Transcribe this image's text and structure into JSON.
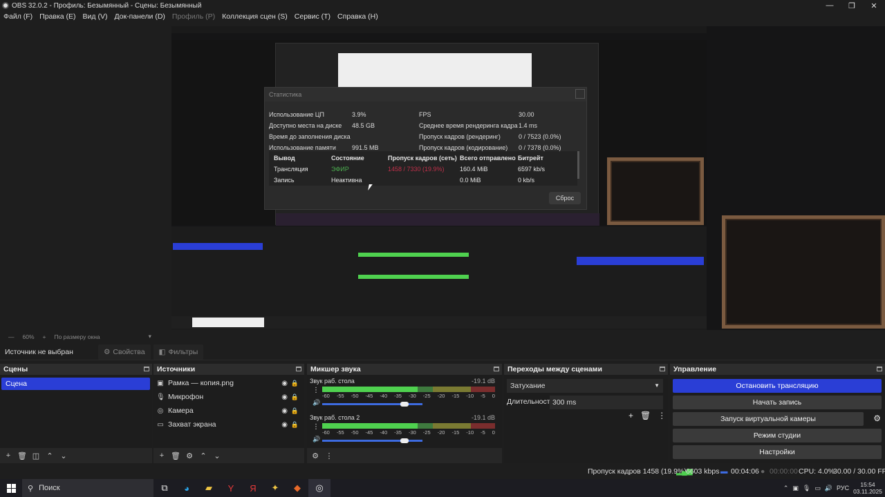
{
  "window": {
    "title": "OBS 32.0.2 - Профиль: Безымянный - Сцены: Безымянный",
    "controls": [
      "—",
      "❐",
      "✕"
    ]
  },
  "menu": [
    {
      "label": "Файл (F)",
      "disabled": false
    },
    {
      "label": "Правка (E)",
      "disabled": false
    },
    {
      "label": "Вид (V)",
      "disabled": false
    },
    {
      "label": "Док-панели (D)",
      "disabled": false
    },
    {
      "label": "Профиль (P)",
      "disabled": true
    },
    {
      "label": "Коллекция сцен (S)",
      "disabled": false
    },
    {
      "label": "Сервис (T)",
      "disabled": false
    },
    {
      "label": "Справка (H)",
      "disabled": false
    }
  ],
  "stats_dialog": {
    "title": "Статистика",
    "left_labels": [
      "Использование ЦП",
      "Доступно места на диске",
      "Время до заполнения диска",
      "Использование памяти"
    ],
    "left_values": [
      "3.9%",
      "48.5 GB",
      "",
      "991.5 MB"
    ],
    "right_labels": [
      "FPS",
      "Среднее время рендеринга кадра",
      "Пропуск кадров (рендеринг)",
      "Пропуск кадров (кодирование)"
    ],
    "right_values": [
      "30.00",
      "1.4 ms",
      "0 / 7523 (0.0%)",
      "0 / 7378 (0.0%)"
    ],
    "output_headers": [
      "Вывод",
      "Состояние",
      "Пропуск кадров (сеть)",
      "Всего отправлено",
      "Битрейт"
    ],
    "outputs": [
      {
        "name": "Трансляция",
        "state": "ЭФИР",
        "dropped": "1458 / 7330 (19.9%)",
        "sent": "160.4 MiB",
        "bitrate": "6597 kb/s"
      },
      {
        "name": "Запись",
        "state": "Неактивна",
        "dropped": "",
        "sent": "0.0 MiB",
        "bitrate": "0 kb/s"
      }
    ],
    "reset_label": "Сброс"
  },
  "zoombar": {
    "zoom": "60%",
    "minus": "—",
    "plus": "+",
    "fit": "По размеру окна"
  },
  "source_bar": {
    "no_source": "Источник не выбран",
    "properties": "Свойства",
    "filters": "Фильтры"
  },
  "scenes": {
    "title": "Сцены",
    "items": [
      "Сцена"
    ]
  },
  "sources": {
    "title": "Источники",
    "items": [
      {
        "label": "Рамка — копия.png",
        "icon": "image-icon"
      },
      {
        "label": "Микрофон",
        "icon": "microphone-icon"
      },
      {
        "label": "Камера",
        "icon": "camera-icon"
      },
      {
        "label": "Захват экрана",
        "icon": "monitor-icon"
      }
    ]
  },
  "mixer": {
    "title": "Микшер звука",
    "ticks": [
      "-60",
      "-55",
      "-50",
      "-45",
      "-40",
      "-35",
      "-30",
      "-25",
      "-20",
      "-15",
      "-10",
      "-5",
      "0"
    ],
    "channels": [
      {
        "name": "Звук раб. стола",
        "db": "-19.1 dB",
        "level": 0.55,
        "volume": 0.82
      },
      {
        "name": "Звук раб. стола 2",
        "db": "-19.1 dB",
        "level": 0.55,
        "volume": 0.82
      }
    ]
  },
  "transitions": {
    "title": "Переходы между сценами",
    "selected": "Затухание",
    "duration_label": "Длительность",
    "duration_value": "300 ms"
  },
  "controls": {
    "title": "Управление",
    "buttons": [
      "Остановить трансляцию",
      "Начать запись",
      "Запуск виртуальной камеры",
      "Режим студии",
      "Настройки"
    ]
  },
  "status": {
    "dropped": "Пропуск кадров 1458 (19.9%)",
    "kbps": "6603 kbps",
    "stream_time": "00:04:06",
    "rec_time": "00:00:00",
    "cpu": "CPU: 4.0%",
    "fps": "30.00 / 30.00 FPS"
  },
  "taskbar": {
    "search": "Поиск",
    "lang": "РУС",
    "time": "15:54",
    "date": "03.11.2025"
  },
  "colors": {
    "accent": "#2a3ed6",
    "live": "#4caf50",
    "dropped": "#c0304a"
  }
}
